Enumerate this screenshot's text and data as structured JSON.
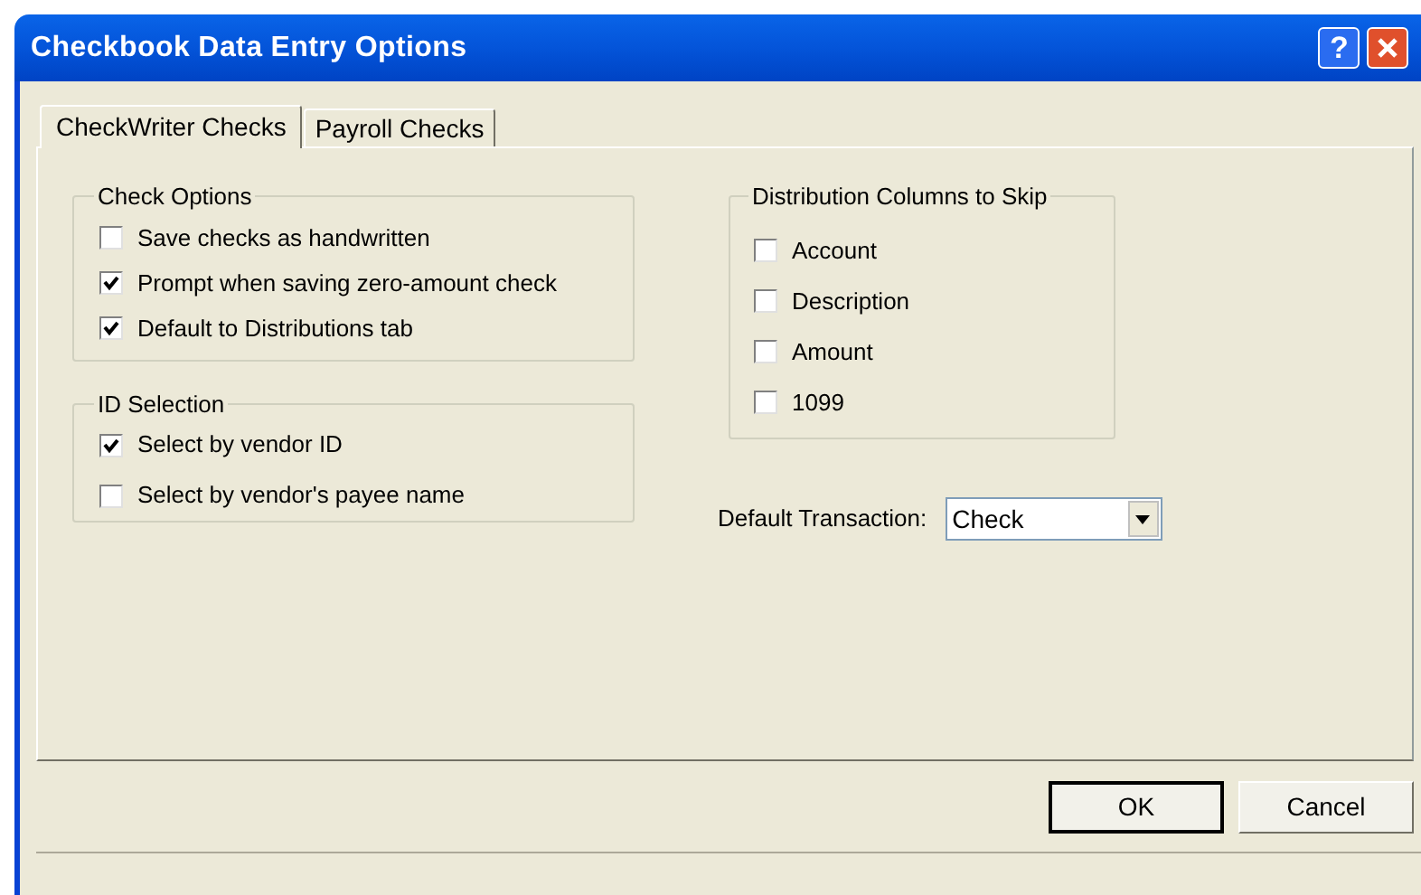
{
  "window": {
    "title": "Checkbook Data Entry Options",
    "help_button": "?"
  },
  "tabs": [
    {
      "label": "CheckWriter Checks",
      "selected": true
    },
    {
      "label": "Payroll Checks",
      "selected": false
    }
  ],
  "check_options": {
    "title": "Check Options",
    "options": [
      {
        "label": "Save checks as handwritten",
        "checked": false
      },
      {
        "label": "Prompt when saving zero-amount check",
        "checked": true
      },
      {
        "label": "Default to Distributions tab",
        "checked": true
      }
    ]
  },
  "id_selection": {
    "title": "ID Selection",
    "options": [
      {
        "label": "Select by vendor ID",
        "checked": true
      },
      {
        "label": "Select by vendor's payee name",
        "checked": false
      }
    ]
  },
  "distribution_columns": {
    "title": "Distribution Columns to Skip",
    "options": [
      {
        "label": "Account",
        "checked": false
      },
      {
        "label": "Description",
        "checked": false
      },
      {
        "label": "Amount",
        "checked": false
      },
      {
        "label": "1099",
        "checked": false
      }
    ]
  },
  "default_transaction": {
    "label": "Default Transaction:",
    "value": "Check"
  },
  "buttons": [
    {
      "label": "OK",
      "default": true
    },
    {
      "label": "Cancel",
      "default": false
    }
  ]
}
